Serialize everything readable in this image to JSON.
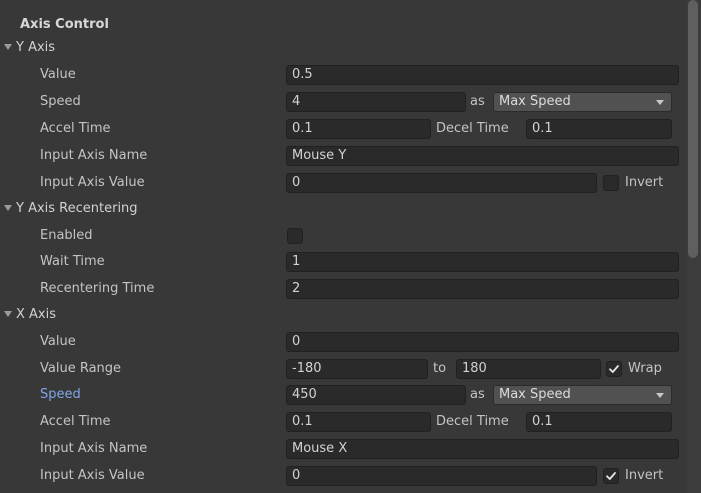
{
  "section_title": "Axis Control",
  "y_axis": {
    "header": "Y Axis",
    "value_label": "Value",
    "value": "0.5",
    "speed_label": "Speed",
    "speed": "4",
    "as_label": "as",
    "speed_mode": "Max Speed",
    "accel_label": "Accel Time",
    "accel": "0.1",
    "decel_label": "Decel Time",
    "decel": "0.1",
    "input_name_label": "Input Axis Name",
    "input_name": "Mouse Y",
    "input_value_label": "Input Axis Value",
    "input_value": "0",
    "invert_label": "Invert",
    "invert_checked": false
  },
  "y_recentering": {
    "header": "Y Axis Recentering",
    "enabled_label": "Enabled",
    "enabled_checked": false,
    "wait_label": "Wait Time",
    "wait": "1",
    "recenter_label": "Recentering Time",
    "recenter": "2"
  },
  "x_axis": {
    "header": "X Axis",
    "value_label": "Value",
    "value": "0",
    "range_label": "Value Range",
    "range_min": "-180",
    "to_label": "to",
    "range_max": "180",
    "wrap_label": "Wrap",
    "wrap_checked": true,
    "speed_label": "Speed",
    "speed": "450",
    "as_label": "as",
    "speed_mode": "Max Speed",
    "accel_label": "Accel Time",
    "accel": "0.1",
    "decel_label": "Decel Time",
    "decel": "0.1",
    "input_name_label": "Input Axis Name",
    "input_name": "Mouse X",
    "input_value_label": "Input Axis Value",
    "input_value": "0",
    "invert_label": "Invert",
    "invert_checked": true
  }
}
